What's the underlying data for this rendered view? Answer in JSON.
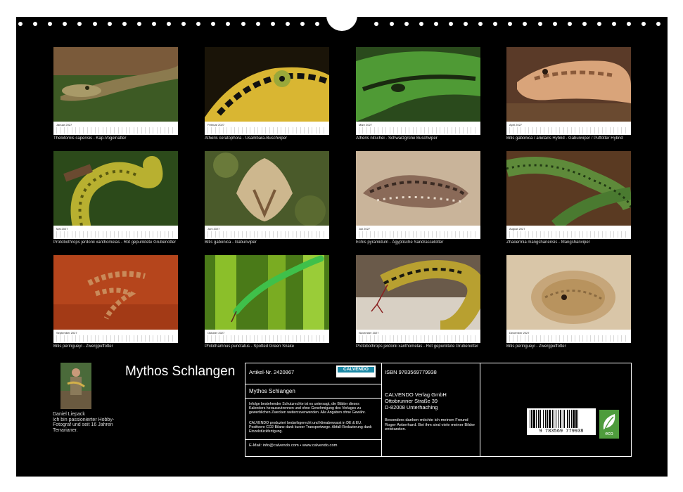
{
  "calendar": {
    "months": [
      {
        "label": "Januar 2027",
        "caption": "Thelotornis capensis - Kap-Vogelnatter"
      },
      {
        "label": "Februar 2027",
        "caption": "Atheris ceratophora - Usambara-Buschviper"
      },
      {
        "label": "März 2027",
        "caption": "Atheris nitschei - Schwarzgrüne Buschviper"
      },
      {
        "label": "April 2027",
        "caption": "Bitis gabonica / arietans Hybrid - Gabunviper / Puffotter Hybrid"
      },
      {
        "label": "Mai 2027",
        "caption": "Protobothrops jerdonii xanthomelas - Rot gepunktete Grubenotter"
      },
      {
        "label": "Juni 2027",
        "caption": "Bitis gabonica - Gabunviper"
      },
      {
        "label": "Juli 2027",
        "caption": "Echis pyramidum - Ägyptische Sandrasselotter"
      },
      {
        "label": "August 2027",
        "caption": "Zhaoermia mangshanensis - Mangshanviper"
      },
      {
        "label": "September 2027",
        "caption": "Bitis peringueyi - Zwergpuffotter"
      },
      {
        "label": "Oktober 2027",
        "caption": "Philothamnus punctatus - Spotted Green Snake"
      },
      {
        "label": "November 2027",
        "caption": "Protobothrops jerdonii xanthomelas - Rot gepunktete Grubenotter"
      },
      {
        "label": "Dezember 2027",
        "caption": "Bitis peringueyi - Zwergpuffotter"
      }
    ]
  },
  "title": "Mythos Schlangen",
  "author": {
    "name": "Daniel Liepack",
    "bio": "Ich bin passionierter Hobby-Fotograf und seit 16 Jahren Terrarianer."
  },
  "info": {
    "article": "Artikel-Nr. 2420867",
    "logo": "CALVENDO",
    "product_title": "Mythos Schlangen",
    "copyright": "Infolge bestehender Schutzrechte ist es untersagt, die Blätter dieses Kalenders herauszutrennen und ohne Genehmigung des Verlages zu gewerblichen Zwecken weiterzuverwenden. Alle Angaben ohne Gewähr.",
    "eco_text": "CALVENDO produziert bedarfsgerecht und klimabewusst in DE & EU. Positivere CO2-Bilanz dank kurzer Transportwege. Abfall-Reduzierung dank Einzelstückfertigung.",
    "contact": "E-Mail: info@calvendo.com • www.calvendo.com",
    "isbn": "ISBN 9783569779938",
    "publisher_name": "CALVENDO Verlag GmbH",
    "publisher_street": "Ottobrunner Straße 39",
    "publisher_city": "D-82008 Unterhaching",
    "thanks": "Besonders danken möchte ich meinen Freund Roger Aeberhard. Bei ihm sind viele meiner Bilder entstanden.",
    "barcode_number": "9 783569 779938",
    "eco_label": "eco"
  },
  "colors": {
    "background": "#000000",
    "eco_green": "#4e9c3c",
    "calvendo_teal": "#1d8aa7"
  }
}
